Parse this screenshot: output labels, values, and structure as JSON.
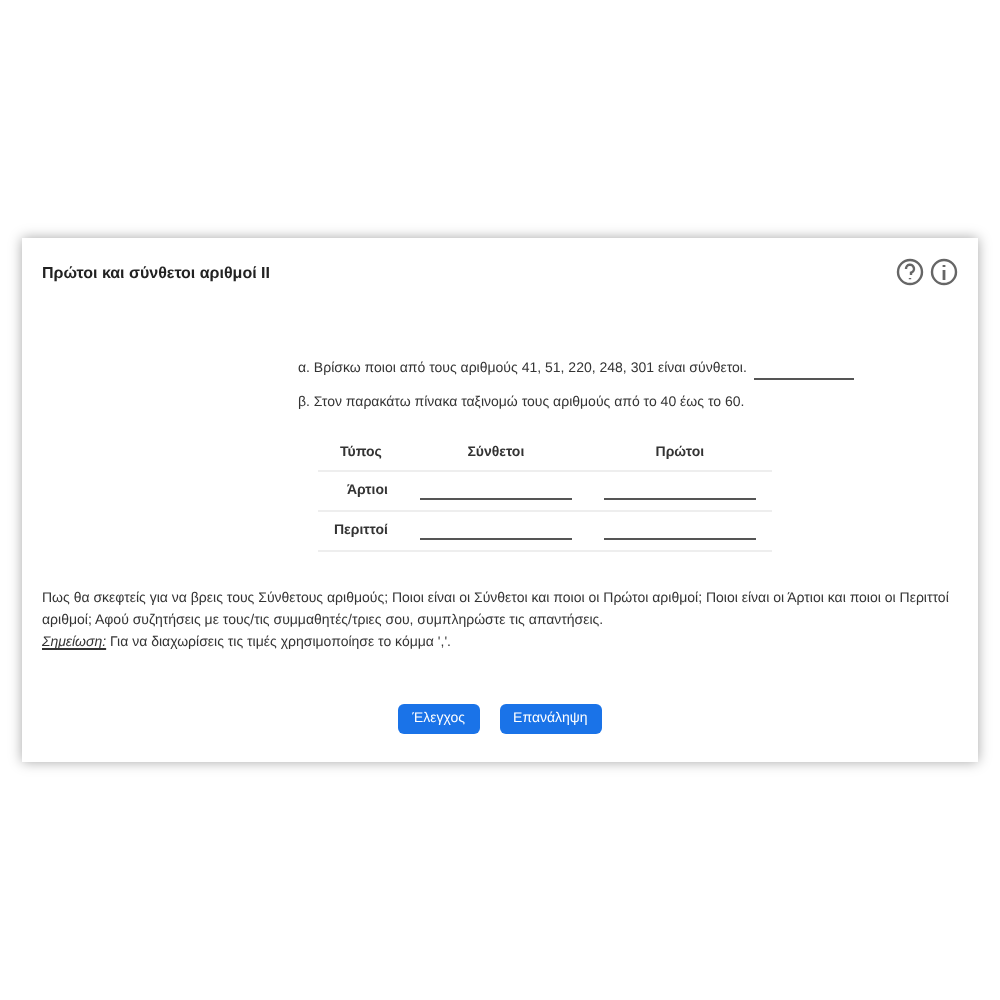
{
  "title": "Πρώτοι και σύνθετοι αριθμοί ΙΙ",
  "questions": [
    {
      "text": "α. Βρίσκω ποιοι από τους αριθμούς 41, 51, 220, 248, 301 είναι σύνθετοι.",
      "kind": "answer"
    },
    {
      "text": "β. Στον παρακάτω πίνακα ταξινομώ τους αριθμούς από το 40 έως το 60.",
      "kind": "plain"
    }
  ],
  "table": {
    "columns": [
      "Τύπος",
      "Σύνθετοι",
      "Πρώτοι"
    ],
    "rows": [
      "Άρτιοι",
      "Περιττοί"
    ]
  },
  "instructions": "Πως θα σκεφτείς για να βρεις τους Σύνθετους αριθμούς; Ποιοι είναι οι Σύνθετοι και ποιοι οι Πρώτοι αριθμοί; Ποιοι είναι οι Άρτιοι και ποιοι οι Περιττοί αριθμοί; Αφού συζητήσεις με τους/τις συμμαθητές/τριες σου, συμπληρώστε τις απαντήσεις.",
  "note": {
    "label": "Σημείωση:",
    "text": "Για να διαχωρίσεις τις τιμές χρησιμοποίησε το κόμμα ','."
  },
  "buttons": [
    "Έλεγχος",
    "Επανάληψη"
  ]
}
